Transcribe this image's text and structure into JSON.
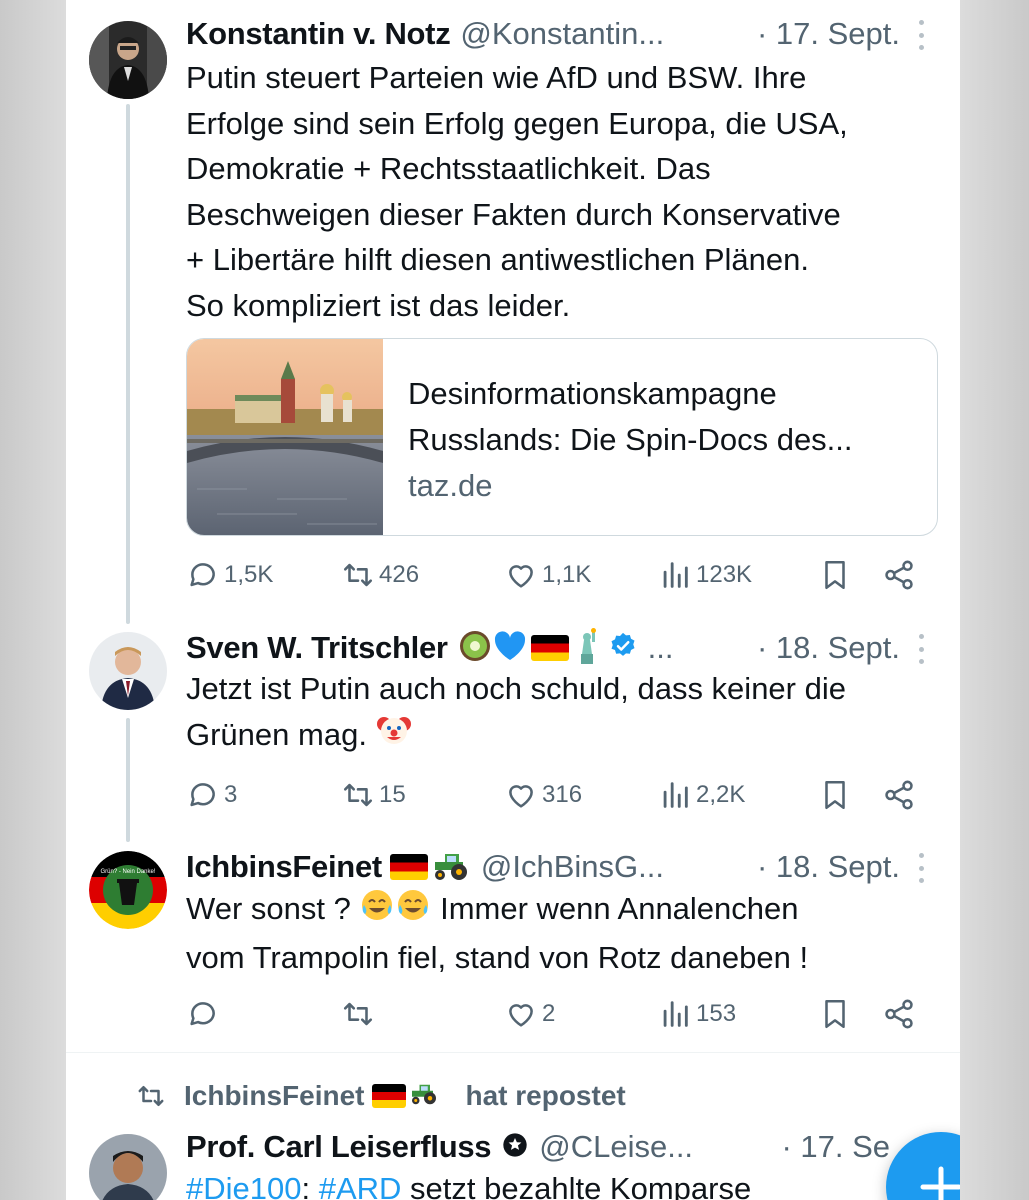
{
  "colors": {
    "accent": "#1d9bf0",
    "text": "#0f1419",
    "muted": "#536471",
    "border": "#cfd9de"
  },
  "tweets": [
    {
      "name": "Konstantin v. Notz",
      "handle": "@Konstantin...",
      "date": "· 17. Sept.",
      "text": "Putin steuert Parteien wie AfD und BSW. Ihre\nErfolge sind sein Erfolg gegen Europa, die USA,\nDemokratie + Rechtsstaatlichkeit. Das\nBeschweigen dieser Fakten durch Konservative\n+ Libertäre hilft diesen antiwestlichen Plänen.\nSo kompliziert ist das leider.",
      "card": {
        "title": "Desinformationskampagne\nRusslands: Die Spin-Docs des...",
        "domain": "taz.de"
      },
      "replies": "1,5K",
      "reposts": "426",
      "likes": "1,1K",
      "views": "123K"
    },
    {
      "name": "Sven W. Tritschler",
      "handle": "...",
      "date": "· 18. Sept.",
      "text_line1": "Jetzt ist Putin auch noch schuld, dass keiner die",
      "text_line2": "Grünen mag.",
      "replies": "3",
      "reposts": "15",
      "likes": "316",
      "views": "2,2K"
    },
    {
      "name": "IchbinsFeinet",
      "handle": "@IchBinsG...",
      "date": "· 18. Sept.",
      "text_line1_a": "Wer sonst ?",
      "text_line1_b": "Immer wenn Annalenchen",
      "text_line2": "vom Trampolin fiel, stand von Rotz daneben !",
      "avatar_text": "Grün? - Nein Danke!",
      "replies": "",
      "reposts": "",
      "likes": "2",
      "views": "153"
    }
  ],
  "repost": {
    "user": "IchbinsFeinet",
    "label": "hat repostet"
  },
  "last_tweet": {
    "name": "Prof. Carl Leiserfluss",
    "handle": "@CLeise...",
    "date": "· 17. Se",
    "tag1": "#Die100",
    "sep": ": ",
    "tag2": "#ARD",
    "rest": " setzt bezahlte Komparse"
  },
  "icons": [
    "reply-icon",
    "repost-icon",
    "like-icon",
    "views-icon",
    "bookmark-icon",
    "share-icon",
    "verified-icon",
    "more-icon",
    "compose-icon"
  ]
}
